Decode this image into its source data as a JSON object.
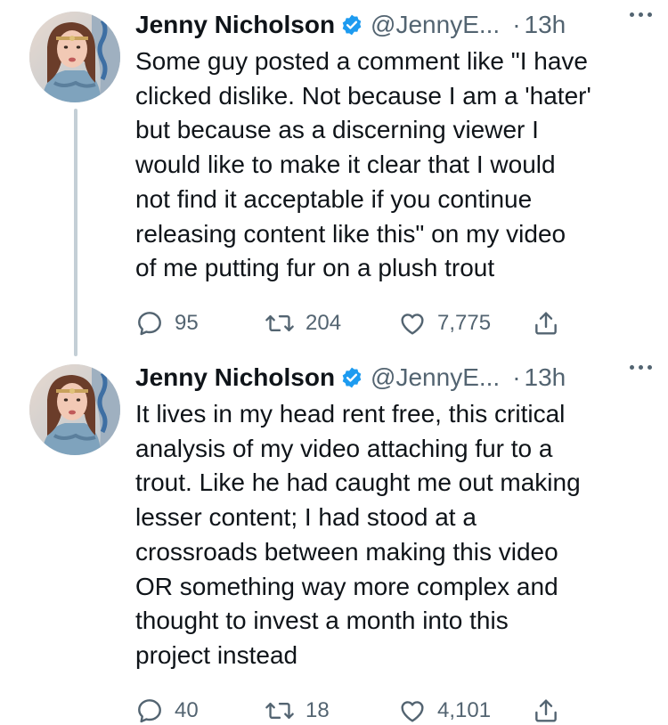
{
  "thread": {
    "tweets": [
      {
        "author": {
          "name": "Jenny Nicholson",
          "handle": "@JennyE...",
          "verified": true
        },
        "separator": "·",
        "time": "13h",
        "text": "Some guy posted a comment like \"I have\nclicked dislike. Not because I am a 'hater'\nbut because as a discerning viewer I\nwould like to make it clear that I would\nnot find it acceptable if you continue\nreleasing content like this\" on my video\nof me putting fur on a plush trout",
        "stats": {
          "replies": "95",
          "retweets": "204",
          "likes": "7,775"
        }
      },
      {
        "author": {
          "name": "Jenny Nicholson",
          "handle": "@JennyE...",
          "verified": true
        },
        "separator": "·",
        "time": "13h",
        "text": "It lives in my head rent free, this critical\nanalysis of my video attaching fur to a\ntrout. Like he had caught me out making\nlesser content; I had stood at a\ncrossroads between making this video\nOR something way more complex and\nthought to invest a month into this\nproject instead",
        "stats": {
          "replies": "40",
          "retweets": "18",
          "likes": "4,101"
        }
      }
    ]
  },
  "colors": {
    "text": "#0f1419",
    "secondary": "#536471",
    "verified": "#1d9bf0",
    "thread_line": "#c4cfd6"
  },
  "icons": {
    "verified": "verified-badge-icon",
    "reply": "reply-icon",
    "retweet": "retweet-icon",
    "like": "heart-icon",
    "share": "share-icon",
    "more": "more-icon"
  }
}
